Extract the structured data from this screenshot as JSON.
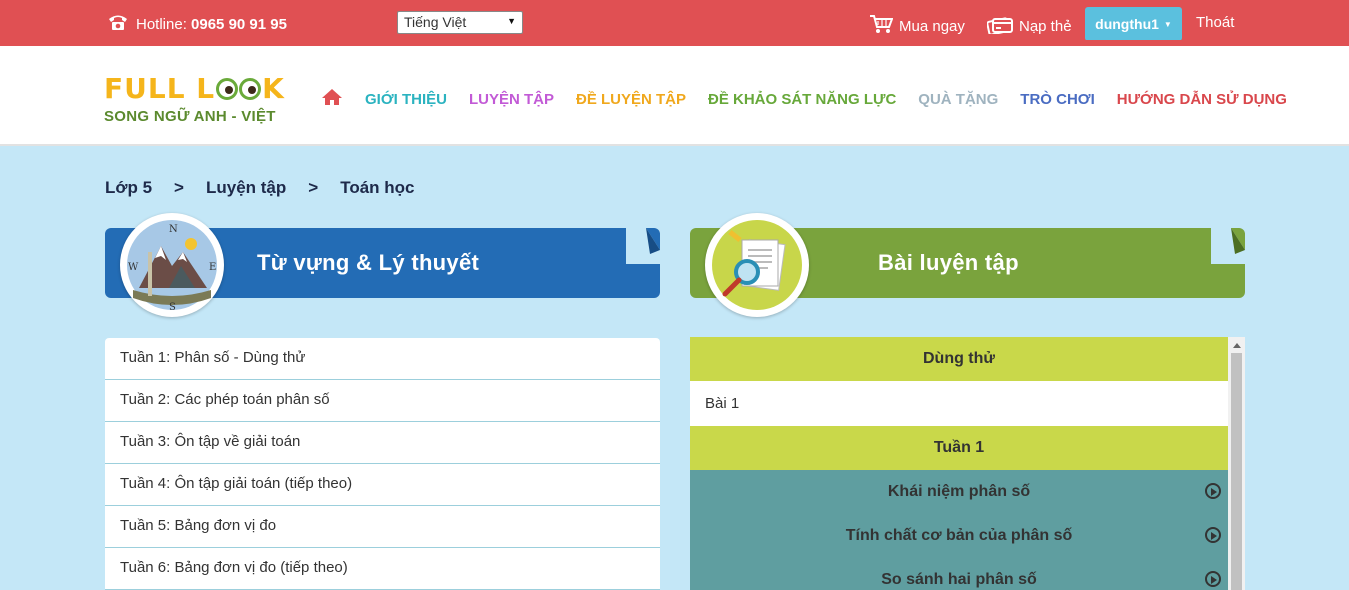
{
  "topbar": {
    "hotline_label": "Hotline: ",
    "hotline_number": "0965 90 91 95",
    "language": "Tiếng Việt",
    "buy": "Mua ngay",
    "topup": "Nạp thẻ",
    "username": "dungthu1",
    "logout": "Thoát"
  },
  "logo": {
    "part1": "FULL L",
    "part2": "K",
    "subtitle": "SONG NGỮ ANH - VIỆT"
  },
  "nav": [
    {
      "label": "GIỚI THIỆU",
      "color": "#2bb3c0"
    },
    {
      "label": "LUYỆN TẬP",
      "color": "#c25ad6"
    },
    {
      "label": "ĐỀ LUYỆN TẬP",
      "color": "#f0a81d"
    },
    {
      "label": "ĐỀ KHẢO SÁT NĂNG LỰC",
      "color": "#67a83a"
    },
    {
      "label": "QUÀ TẶNG",
      "color": "#9fb3bf"
    },
    {
      "label": "TRÒ CHƠI",
      "color": "#4a6cc2"
    },
    {
      "label": "HƯỚNG DẪN SỬ DỤNG",
      "color": "#d9474c"
    }
  ],
  "breadcrumb": {
    "grade": "Lớp 5",
    "sep": ">",
    "section": "Luyện tập",
    "subject": "Toán học"
  },
  "vocab_banner": {
    "title": "Từ vựng & Lý thuyết",
    "color": "#236cb5"
  },
  "practice_banner": {
    "title": "Bài luyện tập",
    "color": "#7aa33d"
  },
  "compass": {
    "n": "N",
    "s": "S",
    "e": "E",
    "w": "W"
  },
  "weeks": [
    "Tuần 1: Phân số - Dùng thử",
    "Tuần 2: Các phép toán phân số",
    "Tuần 3: Ôn tập về giải toán",
    "Tuần 4: Ôn tập giải toán (tiếp theo)",
    "Tuần 5: Bảng đơn vị đo",
    "Tuần 6: Bảng đơn vị đo (tiếp theo)"
  ],
  "practice": {
    "trial_header": "Dùng thử",
    "trial_item": "Bài 1",
    "week1_header": "Tuần 1",
    "topics": [
      "Khái niệm phân số",
      "Tính chất cơ bản của phân số",
      "So sánh hai phân số"
    ]
  },
  "colors": {
    "topbar": "#e05053",
    "page_bg": "#c4e7f7",
    "lime": "#c9d84a",
    "teal": "#5f9ea0",
    "user_button": "#5bc0de"
  }
}
